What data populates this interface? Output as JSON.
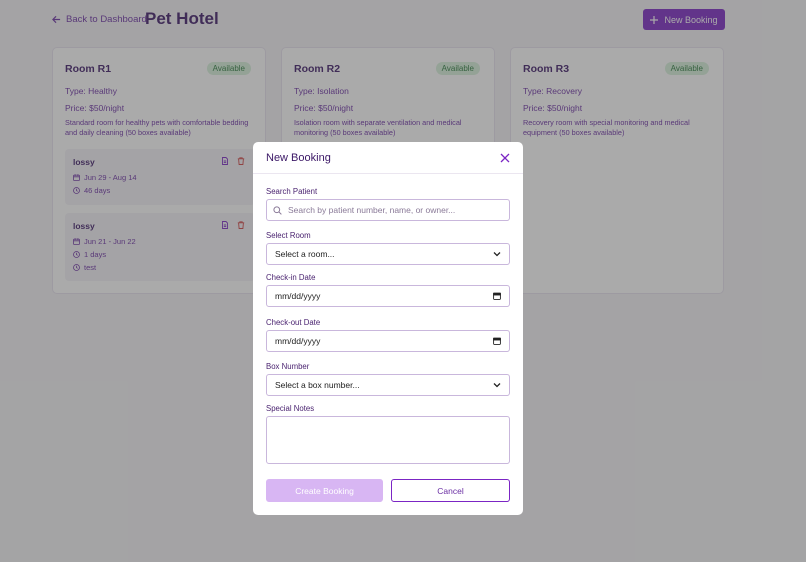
{
  "header": {
    "back_label": "Back to Dashboard",
    "title": "Pet Hotel",
    "new_booking_label": "New Booking"
  },
  "rooms": [
    {
      "name": "Room R1",
      "status": "Available",
      "type": "Type: Healthy",
      "price": "Price: $50/night",
      "description": "Standard room for healthy pets with comfortable bedding and daily cleaning (50 boxes available)",
      "bookings": [
        {
          "pet": "lossy",
          "dates": "Jun 29 - Aug 14",
          "duration": "46 days",
          "note": ""
        },
        {
          "pet": "lossy",
          "dates": "Jun 21 - Jun 22",
          "duration": "1 days",
          "note": "test"
        }
      ]
    },
    {
      "name": "Room R2",
      "status": "Available",
      "type": "Type: Isolation",
      "price": "Price: $50/night",
      "description": "Isolation room with separate ventilation and medical monitoring (50 boxes available)",
      "bookings": []
    },
    {
      "name": "Room R3",
      "status": "Available",
      "type": "Type: Recovery",
      "price": "Price: $50/night",
      "description": "Recovery room with special monitoring and medical equipment (50 boxes available)",
      "bookings": []
    }
  ],
  "modal": {
    "title": "New Booking",
    "search_label": "Search Patient",
    "search_placeholder": "Search by patient number, name, or owner...",
    "room_label": "Select Room",
    "room_value": "Select a room...",
    "checkin_label": "Check-in Date",
    "checkin_value": "mm/dd/yyyy",
    "checkout_label": "Check-out Date",
    "checkout_value": "mm/dd/yyyy",
    "box_label": "Box Number",
    "box_value": "Select a box number...",
    "notes_label": "Special Notes",
    "notes_value": "",
    "create_label": "Create Booking",
    "cancel_label": "Cancel"
  },
  "colors": {
    "accent": "#7b25c4",
    "accent_disabled": "#d8b6f3",
    "status_available_bg": "#d6f0da",
    "status_available_text": "#2a7a3c",
    "delete_icon": "#d04040"
  },
  "icons": {
    "back": "arrow-left-icon",
    "new_booking": "plus-icon",
    "edit": "document-icon",
    "delete": "trash-icon",
    "calendar": "calendar-icon",
    "clock": "clock-icon",
    "search": "search-icon",
    "close": "close-icon",
    "select": "chevron-down-icon",
    "date_picker": "calendar-icon"
  }
}
